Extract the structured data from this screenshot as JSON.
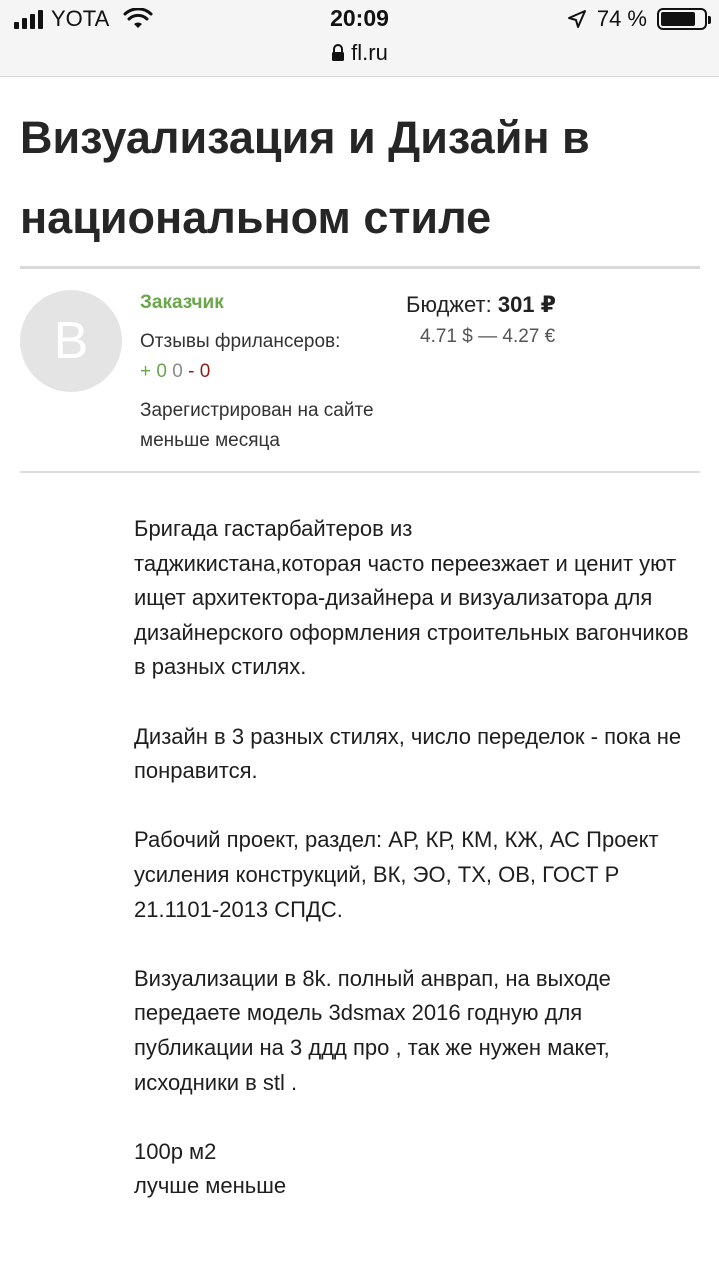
{
  "status_bar": {
    "carrier": "YOTA",
    "time": "20:09",
    "battery_percent": "74 %",
    "url": "fl.ru"
  },
  "project": {
    "title": "Визуализация и Дизайн в национальном стиле"
  },
  "client": {
    "avatar_letter": "B",
    "role": "Заказчик",
    "reviews_label": "Отзывы фрилансеров:",
    "reviews_positive": "+ 0",
    "reviews_neutral": "0",
    "reviews_negative": "- 0",
    "registered": "Зарегистрирован на сайте меньше месяца"
  },
  "budget": {
    "label": "Бюджет:",
    "value": "301 ₽",
    "converted": "4.71 $ — 4.27 €"
  },
  "description": {
    "p1": "Бригада гастарбайтеров из\nтаджикистана,которая часто переезжает и ценит уют ищет архитектора-дизайнера и визуализатора для\nдизайнерского оформления строительных вагончиков в разных стилях.",
    "p2": "Дизайн в 3 разных стилях, число переделок - пока не понравится.",
    "p3": "Рабочий проект, раздел: АР, КР, КМ, КЖ, АС Проект усиления конструкций, ВК, ЭО, ТХ, ОВ, ГОСТ Р 21.1101-2013 СПДС.",
    "p4": "Визуализации в 8k. полный анврап, на выходе передаете модель 3dsmax 2016 годную для публикации на 3 ддд про , так же нужен макет, исходники в stl  .",
    "p5": "100р м2\nлучше меньше"
  },
  "colors": {
    "accent_green": "#6aa64a",
    "negative_red": "#8b1f1f"
  }
}
